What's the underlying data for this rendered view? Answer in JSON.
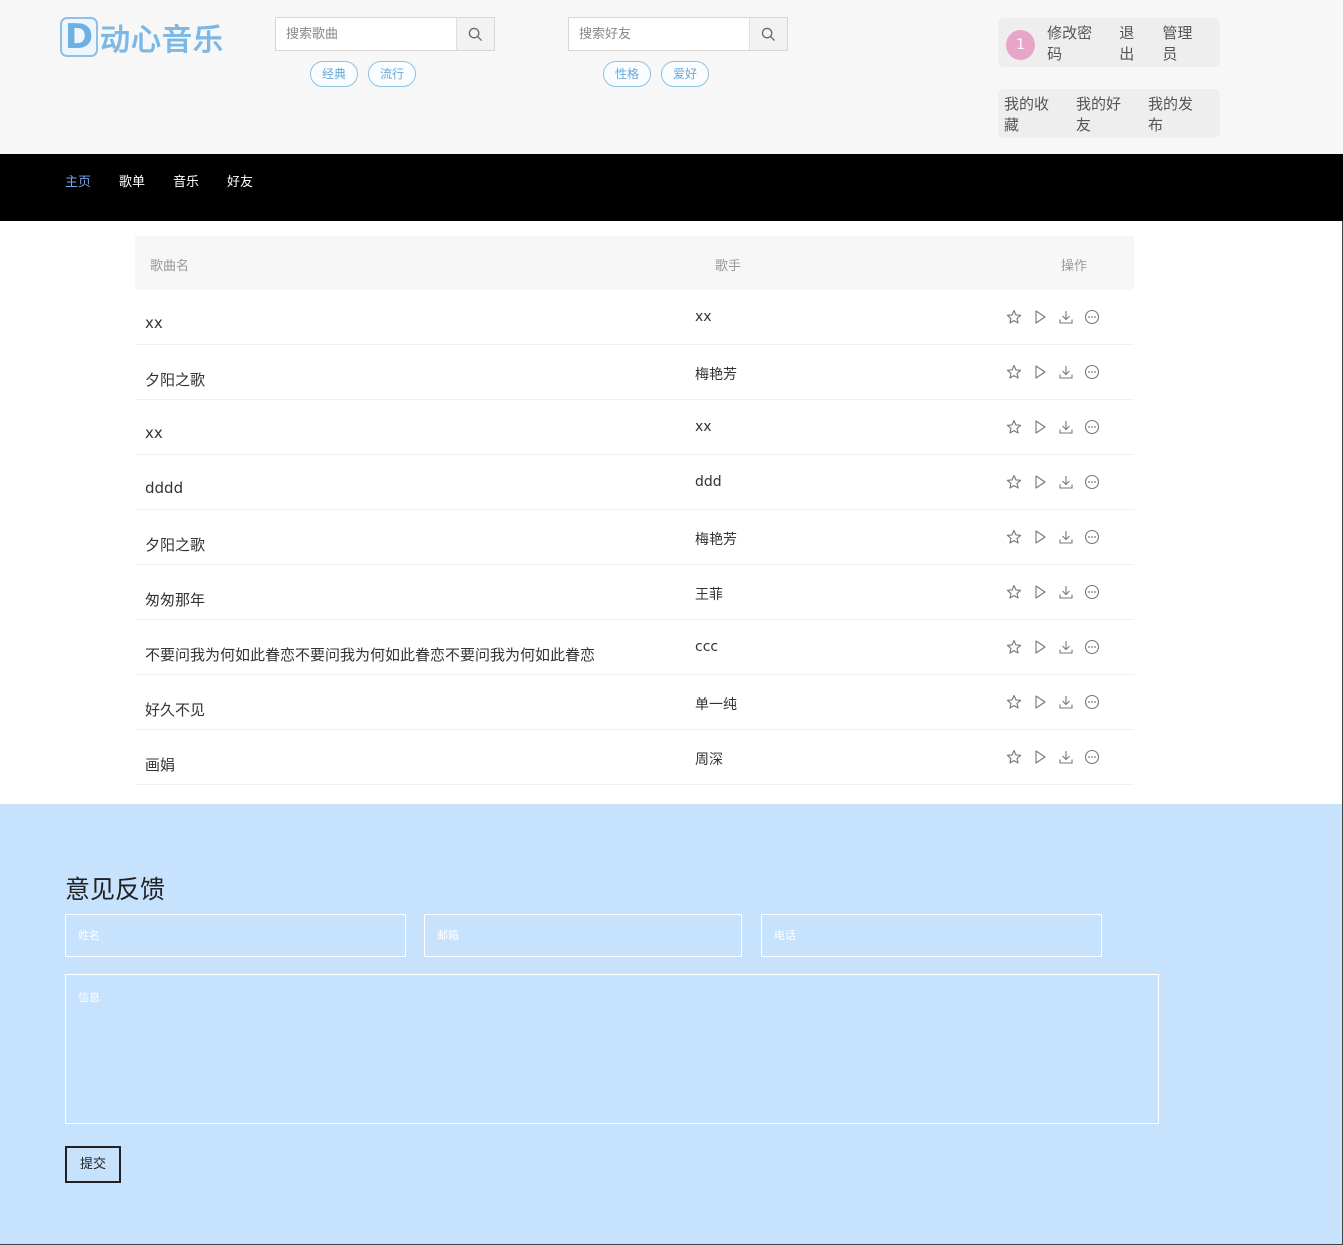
{
  "header": {
    "logo_letter": "D",
    "logo_text": "动心音乐",
    "song_search": {
      "placeholder": "搜索歌曲",
      "tags": [
        "经典",
        "流行"
      ]
    },
    "friend_search": {
      "placeholder": "搜索好友",
      "tags": [
        "性格",
        "爱好"
      ]
    },
    "user": {
      "avatar": "1",
      "change_password": "修改密码",
      "logout": "退出",
      "role": "管理员"
    },
    "my": {
      "favorites": "我的收藏",
      "friends": "我的好友",
      "posts": "我的发布"
    }
  },
  "nav": {
    "items": [
      "主页",
      "歌单",
      "音乐",
      "好友"
    ],
    "active": "主页"
  },
  "table": {
    "headers": {
      "name": "歌曲名",
      "singer": "歌手",
      "ops": "操作"
    },
    "rows": [
      {
        "name": "xx",
        "singer": "xx"
      },
      {
        "name": "夕阳之歌",
        "singer": "梅艳芳"
      },
      {
        "name": "xx",
        "singer": "xx"
      },
      {
        "name": "dddd",
        "singer": "ddd"
      },
      {
        "name": "夕阳之歌",
        "singer": "梅艳芳"
      },
      {
        "name": "匆匆那年",
        "singer": "王菲"
      },
      {
        "name": "不要问我为何如此眷恋不要问我为何如此眷恋不要问我为何如此眷恋",
        "singer": "ccc"
      },
      {
        "name": "好久不见",
        "singer": "单一纯"
      },
      {
        "name": "画娟",
        "singer": "周深"
      }
    ],
    "op_icons": [
      "star-icon",
      "play-icon",
      "download-icon",
      "more-icon"
    ]
  },
  "feedback": {
    "title": "意见反馈",
    "name_placeholder": "姓名",
    "email_placeholder": "邮箱",
    "phone_placeholder": "电话",
    "message_placeholder": "信息",
    "submit": "提交"
  },
  "colors": {
    "accent": "#7cb8e6",
    "nav_active": "#7aa4e3",
    "feedback_bg": "#c6e2fd",
    "avatar": "#e7a6c9"
  }
}
